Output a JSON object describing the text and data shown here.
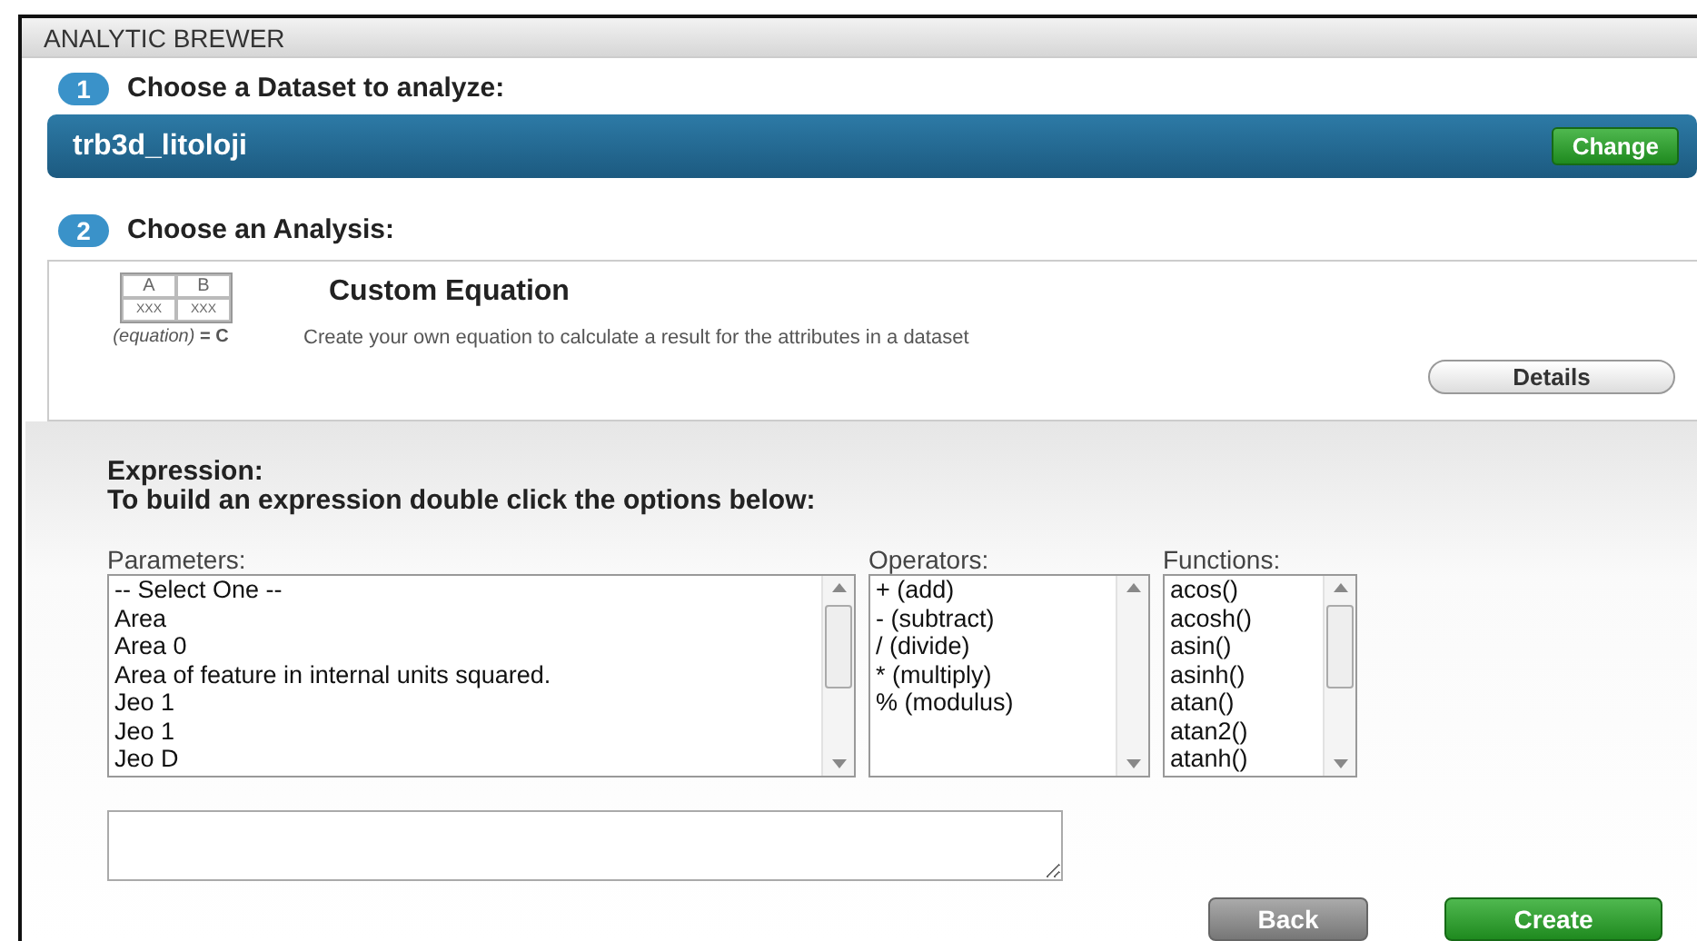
{
  "window": {
    "title": "ANALYTIC BREWER"
  },
  "steps": [
    {
      "number": "1",
      "label": "Choose a Dataset to analyze:"
    },
    {
      "number": "2",
      "label": "Choose an Analysis:"
    }
  ],
  "dataset": {
    "name": "trb3d_litoloji",
    "button": "Change"
  },
  "analysis": {
    "thumbnail": {
      "headers": [
        "A",
        "B"
      ],
      "cells": [
        "XXX",
        "XXX"
      ],
      "formula": "(equation)",
      "result": "= C"
    },
    "title": "Custom Equation",
    "description": "Create your own equation to calculate a result for the attributes in a dataset",
    "button": "Details"
  },
  "expression": {
    "heading": "Expression:",
    "instruction": "To build an expression double click the options below:"
  },
  "lists": [
    {
      "label": "Parameters:",
      "items": [
        "-- Select One --",
        "Area",
        "Area 0",
        "Area of feature in internal units squared.",
        "Jeo 1",
        "Jeo 1",
        "Jeo D"
      ],
      "scrollable": true
    },
    {
      "label": "Operators:",
      "items": [
        "+ (add)",
        "- (subtract)",
        "/ (divide)",
        "* (multiply)",
        "% (modulus)"
      ],
      "scrollable": false
    },
    {
      "label": "Functions:",
      "items": [
        "acos()",
        "acosh()",
        "asin()",
        "asinh()",
        "atan()",
        "atan2()",
        "atanh()"
      ],
      "scrollable": true
    }
  ],
  "buttons": [
    {
      "label": "Back",
      "kind": "secondary"
    },
    {
      "label": "Create",
      "kind": "primary"
    }
  ]
}
